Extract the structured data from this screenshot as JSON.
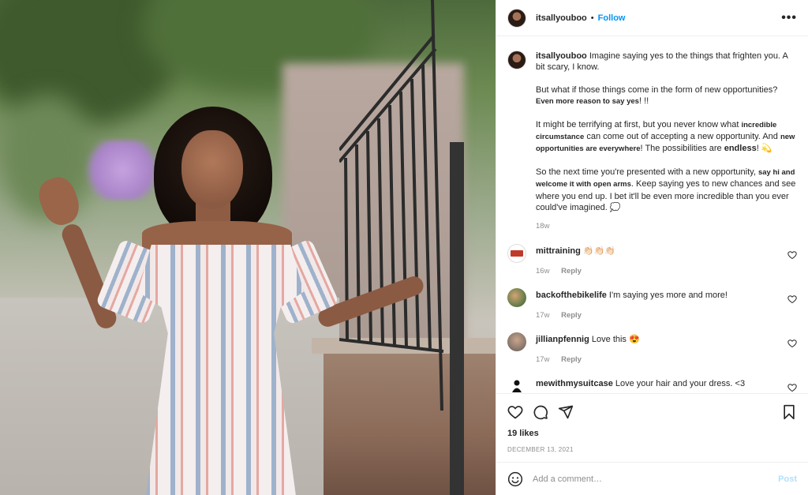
{
  "post": {
    "username": "itsallyouboo",
    "separator": "•",
    "follow_label": "Follow",
    "more_label": "•••"
  },
  "caption": {
    "username": "itsallyouboo",
    "p1": "Imagine saying yes to the things that frighten you. A bit scary, I know.",
    "p2a": "But what if those things come in the form of new opportunities? ",
    "p2b": "Even more reason to say yes",
    "p2c": "! !!",
    "p3a": "It might be terrifying at first, but you never know what ",
    "p3b": "incredible circumstance",
    "p3c": " can come out of accepting a new opportunity. And ",
    "p3d": "new opportunities are everywhere",
    "p3e": "! The possibilities are ",
    "p3f": "endless",
    "p3g": "! 💫",
    "p4a": "So the next time you're presented with a new opportunity, ",
    "p4b": "say hi and welcome it with open arms",
    "p4c": ". Keep saying yes to new chances and see where you end up. I bet it'll be even more incredible than you ever could've imagined. 💭",
    "time": "18w"
  },
  "comments": [
    {
      "username": "mittraining",
      "text": "👏🏻👏🏻👏🏻",
      "time": "16w",
      "reply": "Reply",
      "avatar": "mastery-logo"
    },
    {
      "username": "backofthebikelife",
      "text": "I'm saying yes more and more!",
      "time": "17w",
      "reply": "Reply",
      "avatar": "couple-photo"
    },
    {
      "username": "jillianpfennig",
      "text": "Love this 😍",
      "time": "17w",
      "reply": "Reply",
      "avatar": "portrait-photo"
    },
    {
      "username": "mewithmysuitcase",
      "text": "Love your hair and your dress. <3",
      "time": "",
      "reply": "",
      "avatar": "silhouette-logo"
    }
  ],
  "actions": {
    "likes": "19 likes",
    "date": "DECEMBER 13, 2021"
  },
  "add_comment": {
    "placeholder": "Add a comment…",
    "post_label": "Post"
  },
  "colors": {
    "link_blue": "#0095f6",
    "post_disabled": "#b2dffc",
    "muted": "#8e8e8e"
  }
}
